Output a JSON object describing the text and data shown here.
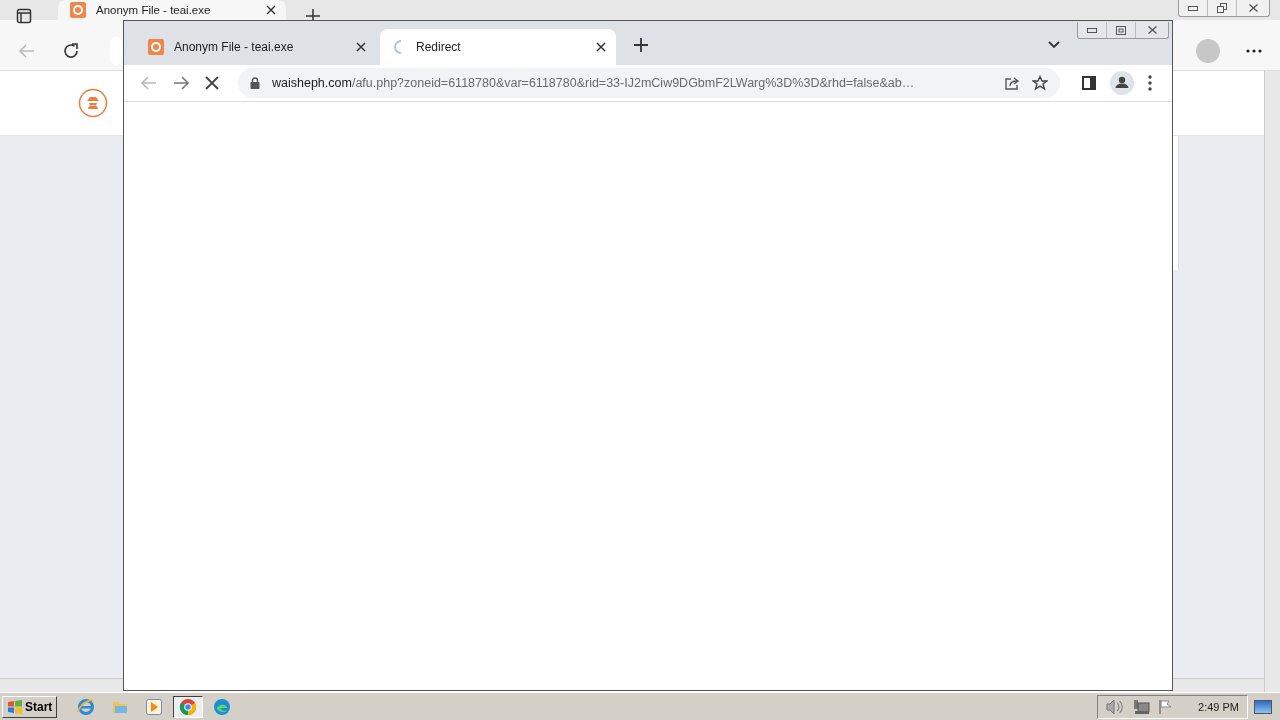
{
  "back_window": {
    "tabs": [
      {
        "label": "Anonym File - teai.exe",
        "selected": true
      }
    ],
    "nav": {
      "back_disabled": true
    }
  },
  "front_window": {
    "tabs": [
      {
        "label": "Anonym File - teai.exe",
        "selected": false,
        "loading": false
      },
      {
        "label": "Redirect",
        "selected": true,
        "loading": true
      }
    ],
    "nav": {
      "back_disabled": true,
      "forward_disabled": false,
      "loading": true
    },
    "url": {
      "host": "waisheph.com",
      "path": "/afu.php?zoneid=6118780&var=6118780&rid=33-IJ2mCiw9DGbmF2LWarg%3D%3D&rhd=false&ab…"
    }
  },
  "taskbar": {
    "start": "Start",
    "apps": [
      {
        "kind": "ie",
        "selected": false
      },
      {
        "kind": "explorer",
        "selected": false
      },
      {
        "kind": "media",
        "selected": false
      },
      {
        "kind": "chrome",
        "selected": true
      },
      {
        "kind": "edge",
        "selected": false
      }
    ],
    "clock": "2:49 PM"
  }
}
